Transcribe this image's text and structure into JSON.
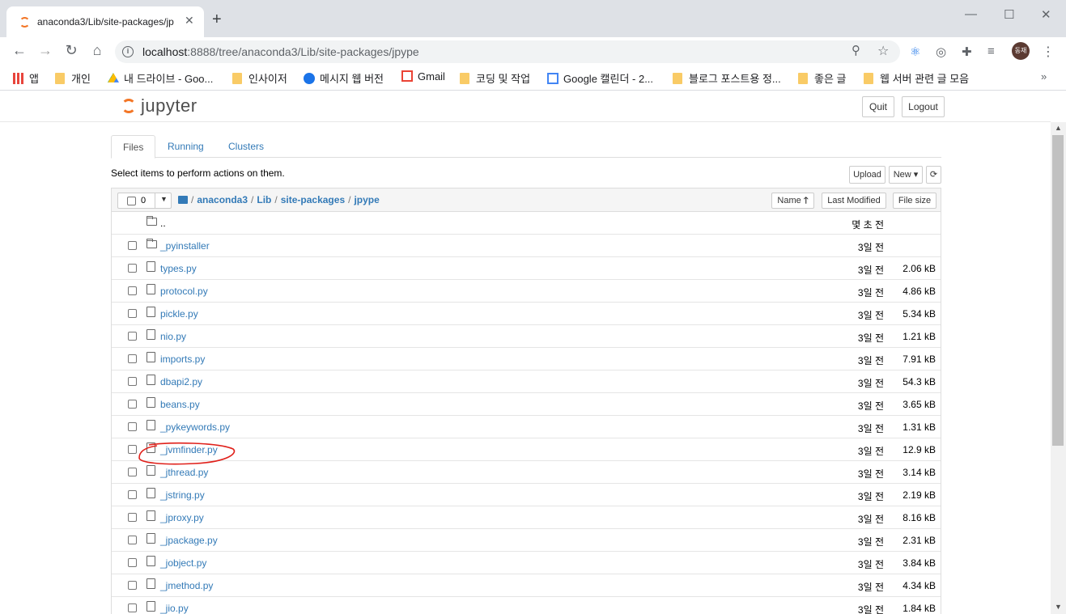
{
  "browser": {
    "tab_title": "anaconda3/Lib/site-packages/jp",
    "url_host": "localhost",
    "url_rest": ":8888/tree/anaconda3/Lib/site-packages/jpype",
    "avatar_text": "동재",
    "bookmarks": [
      {
        "label": "앱",
        "icon": "apps-grid-icon"
      },
      {
        "label": "개인",
        "icon": "folder-icon"
      },
      {
        "label": "내 드라이브 - Goo...",
        "icon": "google-drive-icon"
      },
      {
        "label": "인사이저",
        "icon": "folder-icon"
      },
      {
        "label": "메시지 웹 버전",
        "icon": "messages-icon"
      },
      {
        "label": "Gmail",
        "icon": "gmail-icon"
      },
      {
        "label": "코딩 및 작업",
        "icon": "folder-icon"
      },
      {
        "label": "Google 캘린더 - 2...",
        "icon": "calendar-icon"
      },
      {
        "label": "블로그 포스트용 정...",
        "icon": "folder-icon"
      },
      {
        "label": "좋은 글",
        "icon": "folder-icon"
      },
      {
        "label": "웹 서버 관련 글 모음",
        "icon": "folder-icon"
      }
    ]
  },
  "jupyter": {
    "logo_text": "jupyter",
    "quit_label": "Quit",
    "logout_label": "Logout",
    "tabs": [
      "Files",
      "Running",
      "Clusters"
    ],
    "hint": "Select items to perform actions on them.",
    "upload_label": "Upload",
    "new_label": "New",
    "selected_count": "0",
    "breadcrumb": [
      "anaconda3",
      "Lib",
      "site-packages",
      "jpype"
    ],
    "sort_buttons": {
      "name": "Name",
      "last_modified": "Last Modified",
      "file_size": "File size"
    },
    "parent_dir": "..",
    "parent_modified": "몇 초 전",
    "files": [
      {
        "name": "_pyinstaller",
        "type": "folder",
        "modified": "3일 전",
        "size": ""
      },
      {
        "name": "types.py",
        "type": "file",
        "modified": "3일 전",
        "size": "2.06 kB"
      },
      {
        "name": "protocol.py",
        "type": "file",
        "modified": "3일 전",
        "size": "4.86 kB"
      },
      {
        "name": "pickle.py",
        "type": "file",
        "modified": "3일 전",
        "size": "5.34 kB"
      },
      {
        "name": "nio.py",
        "type": "file",
        "modified": "3일 전",
        "size": "1.21 kB"
      },
      {
        "name": "imports.py",
        "type": "file",
        "modified": "3일 전",
        "size": "7.91 kB"
      },
      {
        "name": "dbapi2.py",
        "type": "file",
        "modified": "3일 전",
        "size": "54.3 kB"
      },
      {
        "name": "beans.py",
        "type": "file",
        "modified": "3일 전",
        "size": "3.65 kB"
      },
      {
        "name": "_pykeywords.py",
        "type": "file",
        "modified": "3일 전",
        "size": "1.31 kB"
      },
      {
        "name": "_jvmfinder.py",
        "type": "file",
        "modified": "3일 전",
        "size": "12.9 kB",
        "highlighted": true
      },
      {
        "name": "_jthread.py",
        "type": "file",
        "modified": "3일 전",
        "size": "3.14 kB"
      },
      {
        "name": "_jstring.py",
        "type": "file",
        "modified": "3일 전",
        "size": "2.19 kB"
      },
      {
        "name": "_jproxy.py",
        "type": "file",
        "modified": "3일 전",
        "size": "8.16 kB"
      },
      {
        "name": "_jpackage.py",
        "type": "file",
        "modified": "3일 전",
        "size": "2.31 kB"
      },
      {
        "name": "_jobject.py",
        "type": "file",
        "modified": "3일 전",
        "size": "3.84 kB"
      },
      {
        "name": "_jmethod.py",
        "type": "file",
        "modified": "3일 전",
        "size": "4.34 kB"
      },
      {
        "name": "_jio.py",
        "type": "file",
        "modified": "3일 전",
        "size": "1.84 kB"
      }
    ],
    "colors": {
      "link": "#337ab7",
      "logo_orange": "#f37626",
      "annotation_red": "#e0201a"
    }
  }
}
